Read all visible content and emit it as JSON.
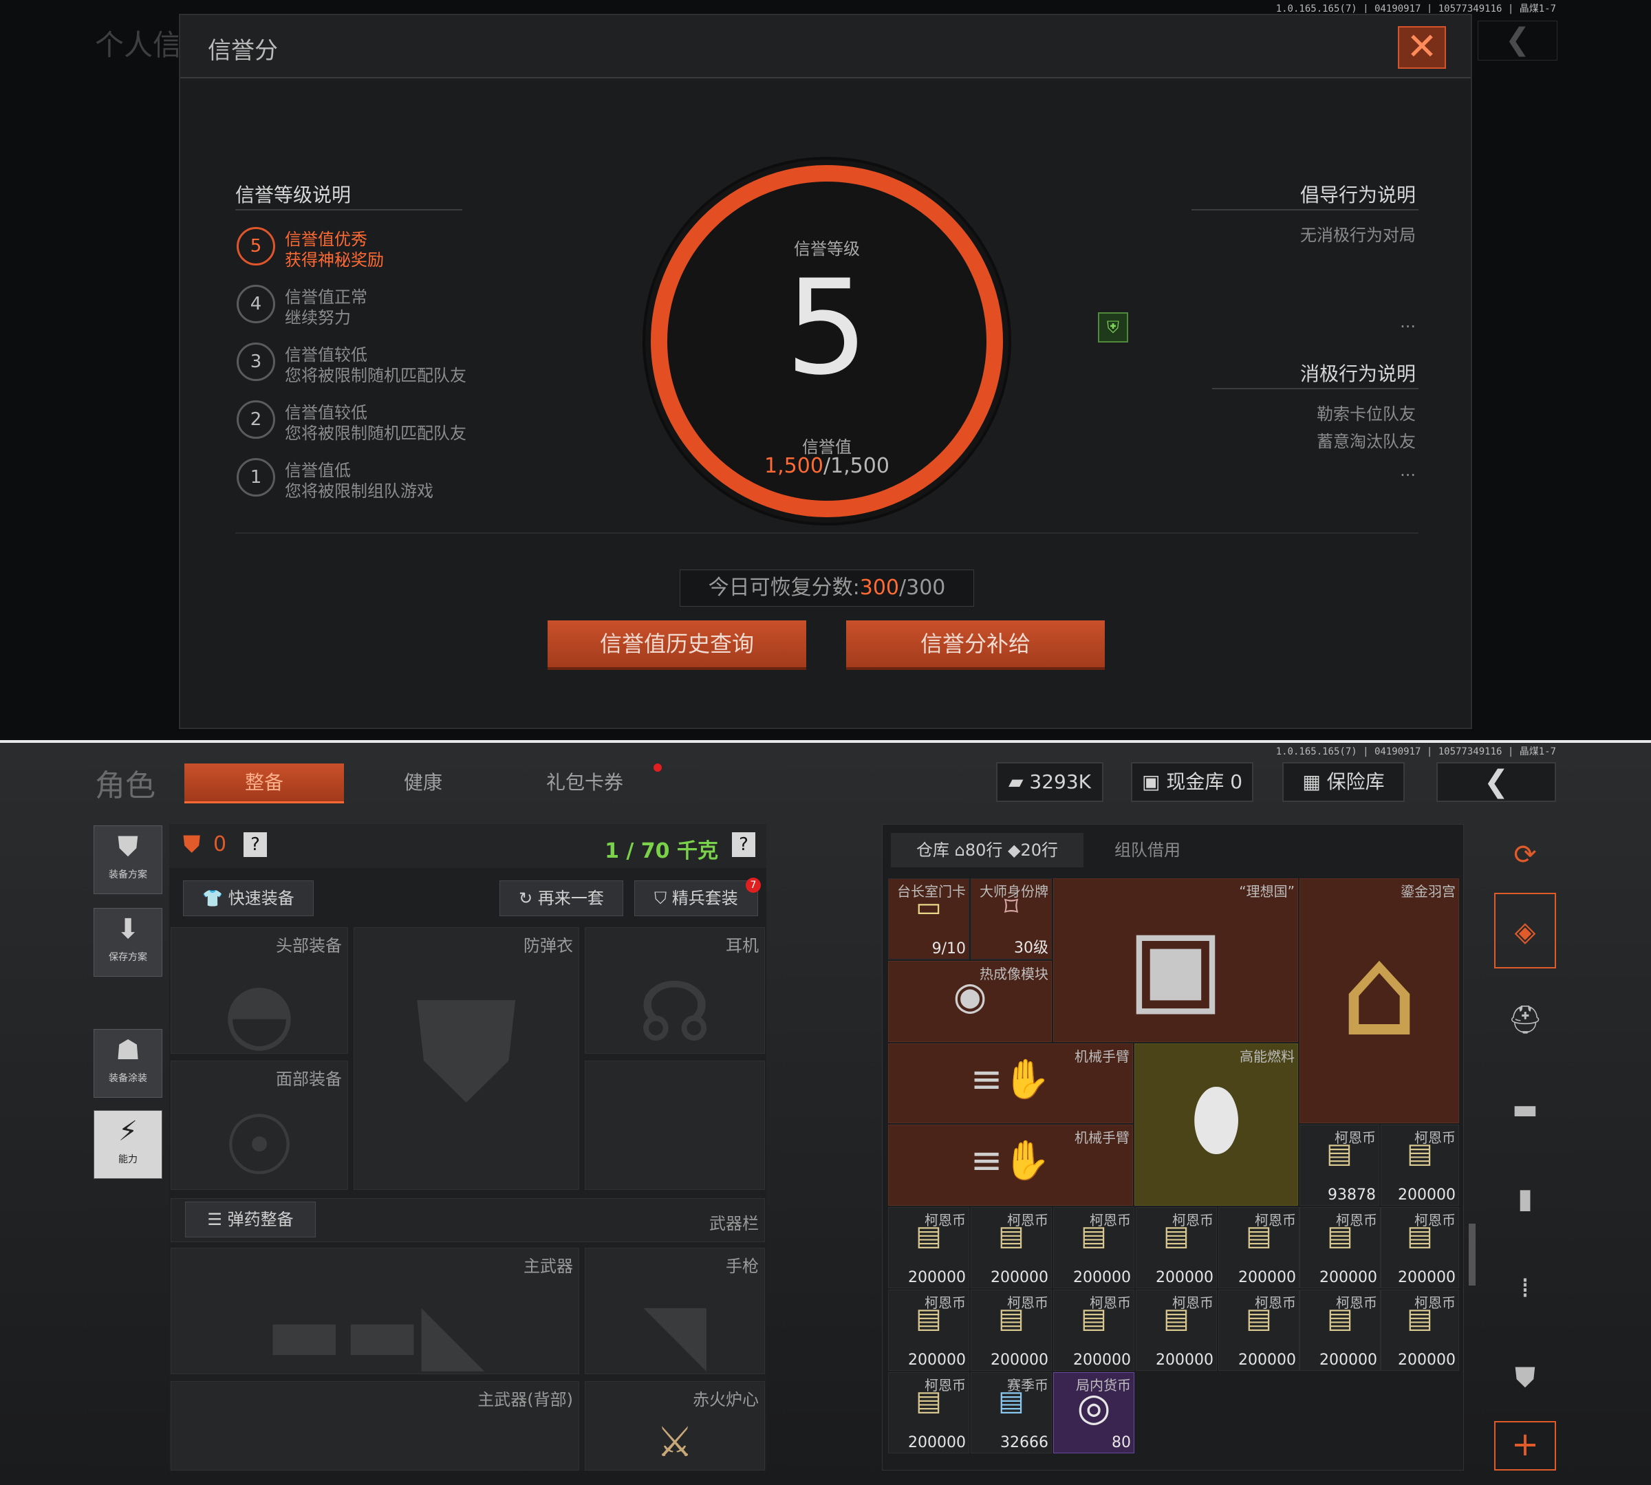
{
  "version_top": "1.0.165.165(7) | 04190917 | 10577349116 | 晶煤1-7",
  "version_bottom": "1.0.165.165(7) | 04190917 | 10577349116 | 晶煤1-7",
  "background": {
    "title": "个人信"
  },
  "modal": {
    "title": "信誉分",
    "section_levels_title": "信誉等级说明",
    "levels": [
      {
        "num": "5",
        "line1": "信誉值优秀",
        "line2": "获得神秘奖励",
        "active": true
      },
      {
        "num": "4",
        "line1": "信誉值正常",
        "line2": "继续努力",
        "active": false
      },
      {
        "num": "3",
        "line1": "信誉值较低",
        "line2": "您将被限制随机匹配队友",
        "active": false
      },
      {
        "num": "2",
        "line1": "信誉值较低",
        "line2": "您将被限制随机匹配队友",
        "active": false
      },
      {
        "num": "1",
        "line1": "信誉值低",
        "line2": "您将被限制组队游戏",
        "active": false
      }
    ],
    "ring": {
      "label": "信誉等级",
      "level": "5",
      "value_label": "信誉值",
      "value_current": "1,500",
      "value_max": "/1,500"
    },
    "positive_title": "倡导行为说明",
    "positive_items": [
      "无消极行为对局"
    ],
    "negative_title": "消极行为说明",
    "negative_items": [
      "勒索卡位队友",
      "蓄意淘汰队友"
    ],
    "more": "...",
    "recover_label": "今日可恢复分数:",
    "recover_current": "300",
    "recover_max": "/300",
    "btn_history": "信誉值历史查询",
    "btn_supply": "信誉分补给"
  },
  "inventory": {
    "role_title": "角色",
    "tabs": [
      "整备",
      "健康",
      "礼包卡券"
    ],
    "currency": "3293K",
    "cash_vault": "现金库 0",
    "safe": "保险库",
    "side_buttons": [
      "装备方案",
      "保存方案",
      "装备涂装",
      "能力"
    ],
    "armor_count": "0",
    "weight": "1 / 70 千克",
    "help": "?",
    "quick_equip": "快速装备",
    "again": "再来一套",
    "elite": "精兵套装",
    "elite_badge": "7",
    "slots": {
      "head": "头部装备",
      "vest": "防弹衣",
      "ear": "耳机",
      "face": "面部装备",
      "ammo": "弹药整备",
      "weapon_bar": "武器栏",
      "main": "主武器",
      "pistol": "手枪",
      "main_back": "主武器(背部)",
      "melee": "赤火炉心"
    },
    "storage_tabs": {
      "warehouse": "仓库",
      "rows1": "80行",
      "rows2": "20行",
      "team": "组队借用"
    },
    "items": [
      {
        "name": "台长室门卡",
        "count": "9/10"
      },
      {
        "name": "大师身份牌",
        "count": "30级"
      },
      {
        "name": "“理想国”",
        "count": ""
      },
      {
        "name": "鎏金羽宫",
        "count": ""
      },
      {
        "name": "热成像模块",
        "count": ""
      },
      {
        "name": "机械手臂",
        "count": ""
      },
      {
        "name": "高能燃料",
        "count": ""
      },
      {
        "name": "机械手臂",
        "count": ""
      },
      {
        "name": "柯恩币",
        "count": "93878"
      },
      {
        "name": "柯恩币",
        "count": "200000"
      }
    ],
    "coin_name": "柯恩币",
    "coin_count": "200000",
    "last_row": [
      {
        "name": "柯恩币",
        "count": "200000"
      },
      {
        "name": "赛季币",
        "count": "32666"
      },
      {
        "name": "局内货币",
        "count": "80"
      }
    ]
  }
}
